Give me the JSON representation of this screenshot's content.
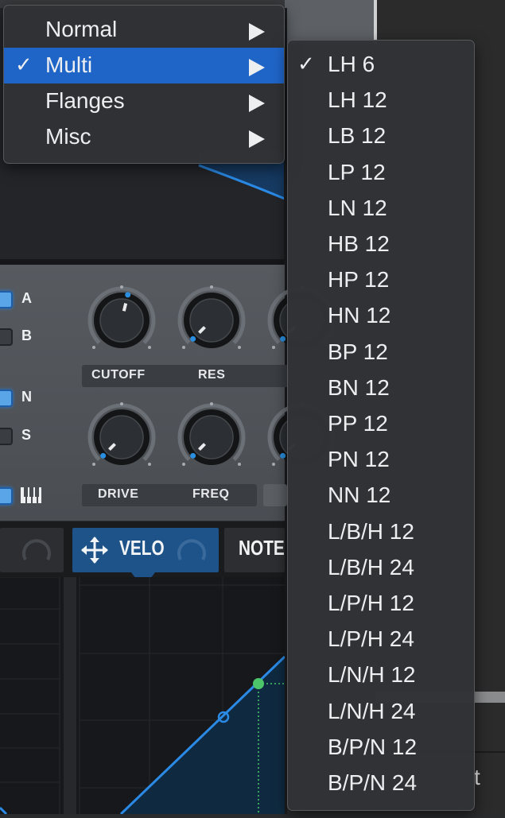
{
  "filter_type_menu": {
    "items": [
      {
        "label": "Normal",
        "checked": false,
        "highlighted": false,
        "has_submenu": true
      },
      {
        "label": "Multi",
        "checked": true,
        "highlighted": true,
        "has_submenu": true
      },
      {
        "label": "Flanges",
        "checked": false,
        "highlighted": false,
        "has_submenu": true
      },
      {
        "label": "Misc",
        "checked": false,
        "highlighted": false,
        "has_submenu": true
      }
    ],
    "check_glyph": "✓"
  },
  "multi_submenu": {
    "items": [
      {
        "label": "LH 6",
        "checked": true
      },
      {
        "label": "LH 12",
        "checked": false
      },
      {
        "label": "LB 12",
        "checked": false
      },
      {
        "label": "LP 12",
        "checked": false
      },
      {
        "label": "LN 12",
        "checked": false
      },
      {
        "label": "HB 12",
        "checked": false
      },
      {
        "label": "HP 12",
        "checked": false
      },
      {
        "label": "HN 12",
        "checked": false
      },
      {
        "label": "BP 12",
        "checked": false
      },
      {
        "label": "BN 12",
        "checked": false
      },
      {
        "label": "PP 12",
        "checked": false
      },
      {
        "label": "PN 12",
        "checked": false
      },
      {
        "label": "NN 12",
        "checked": false
      },
      {
        "label": "L/B/H 12",
        "checked": false
      },
      {
        "label": "L/B/H 24",
        "checked": false
      },
      {
        "label": "L/P/H 12",
        "checked": false
      },
      {
        "label": "L/P/H 24",
        "checked": false
      },
      {
        "label": "L/N/H 12",
        "checked": false
      },
      {
        "label": "L/N/H 24",
        "checked": false
      },
      {
        "label": "B/P/N 12",
        "checked": false
      },
      {
        "label": "B/P/N 24",
        "checked": false
      }
    ]
  },
  "filter_panel": {
    "toggles": [
      {
        "label": "A",
        "on": true
      },
      {
        "label": "B",
        "on": false
      },
      {
        "label": "N",
        "on": true
      },
      {
        "label": "S",
        "on": false
      },
      {
        "label": "keyboard-icon",
        "on": true
      }
    ],
    "knobs": [
      {
        "label": "CUTOFF",
        "value": 0.55
      },
      {
        "label": "RES",
        "value": 0.0
      },
      {
        "label": "DRIVE",
        "value": 0.0
      },
      {
        "label": "FREQ",
        "value": 0.0
      }
    ]
  },
  "mod_tabs": {
    "items": [
      {
        "label": "",
        "active": false
      },
      {
        "label": "VELO",
        "active": true
      },
      {
        "label": "NOTE",
        "active": false
      }
    ]
  },
  "peek_text": "t",
  "colors": {
    "accent": "#1f65c8",
    "knob_indicator": "#2a8fe0",
    "curve": "#2a8ae6",
    "point_green": "#4cc46a"
  }
}
